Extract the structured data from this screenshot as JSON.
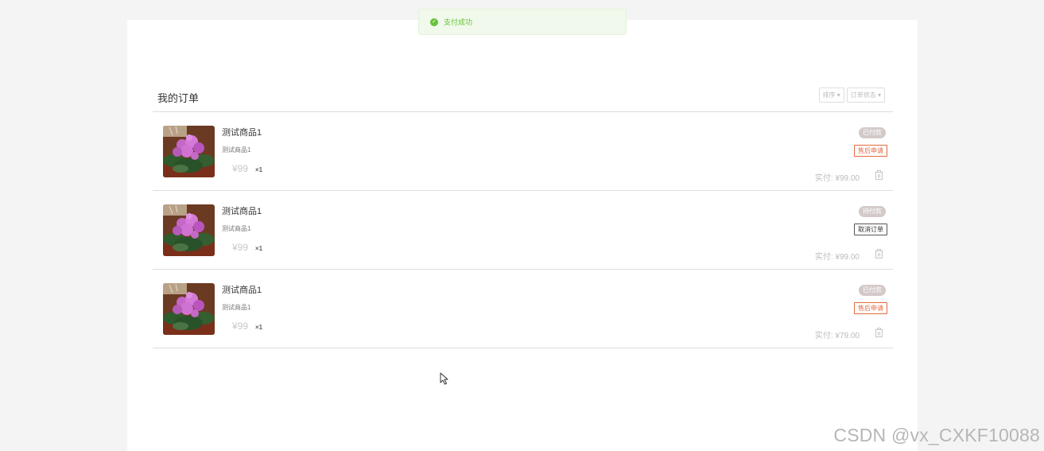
{
  "toast": {
    "message": "支付成功"
  },
  "header": {
    "title": "我的订单",
    "sort_label": "排序",
    "status_label": "订单状态"
  },
  "orders": [
    {
      "name": "测试商品1",
      "desc": "测试商品1",
      "price": "¥99",
      "qty": "×1",
      "status": "已付款",
      "action": "售后申请",
      "action_type": "after",
      "paid": "实付: ¥99.00"
    },
    {
      "name": "测试商品1",
      "desc": "测试商品1",
      "price": "¥99",
      "qty": "×1",
      "status": "待付款",
      "action": "取消订单",
      "action_type": "cancel",
      "paid": "实付: ¥99.00"
    },
    {
      "name": "测试商品1",
      "desc": "测试商品1",
      "price": "¥99",
      "qty": "×1",
      "status": "已付款",
      "action": "售后申请",
      "action_type": "after",
      "paid": "实付: ¥79.00"
    }
  ],
  "icons": {
    "toast": "check-circle-icon",
    "dropdown": "caret-down-icon",
    "delete": "trash-icon",
    "cursor": "mouse-cursor-icon"
  },
  "colors": {
    "success": "#67c23a",
    "after_sale": "#e46a3d",
    "status_badge": "#d4c9c9"
  },
  "watermark": "CSDN @vx_CXKF10088"
}
